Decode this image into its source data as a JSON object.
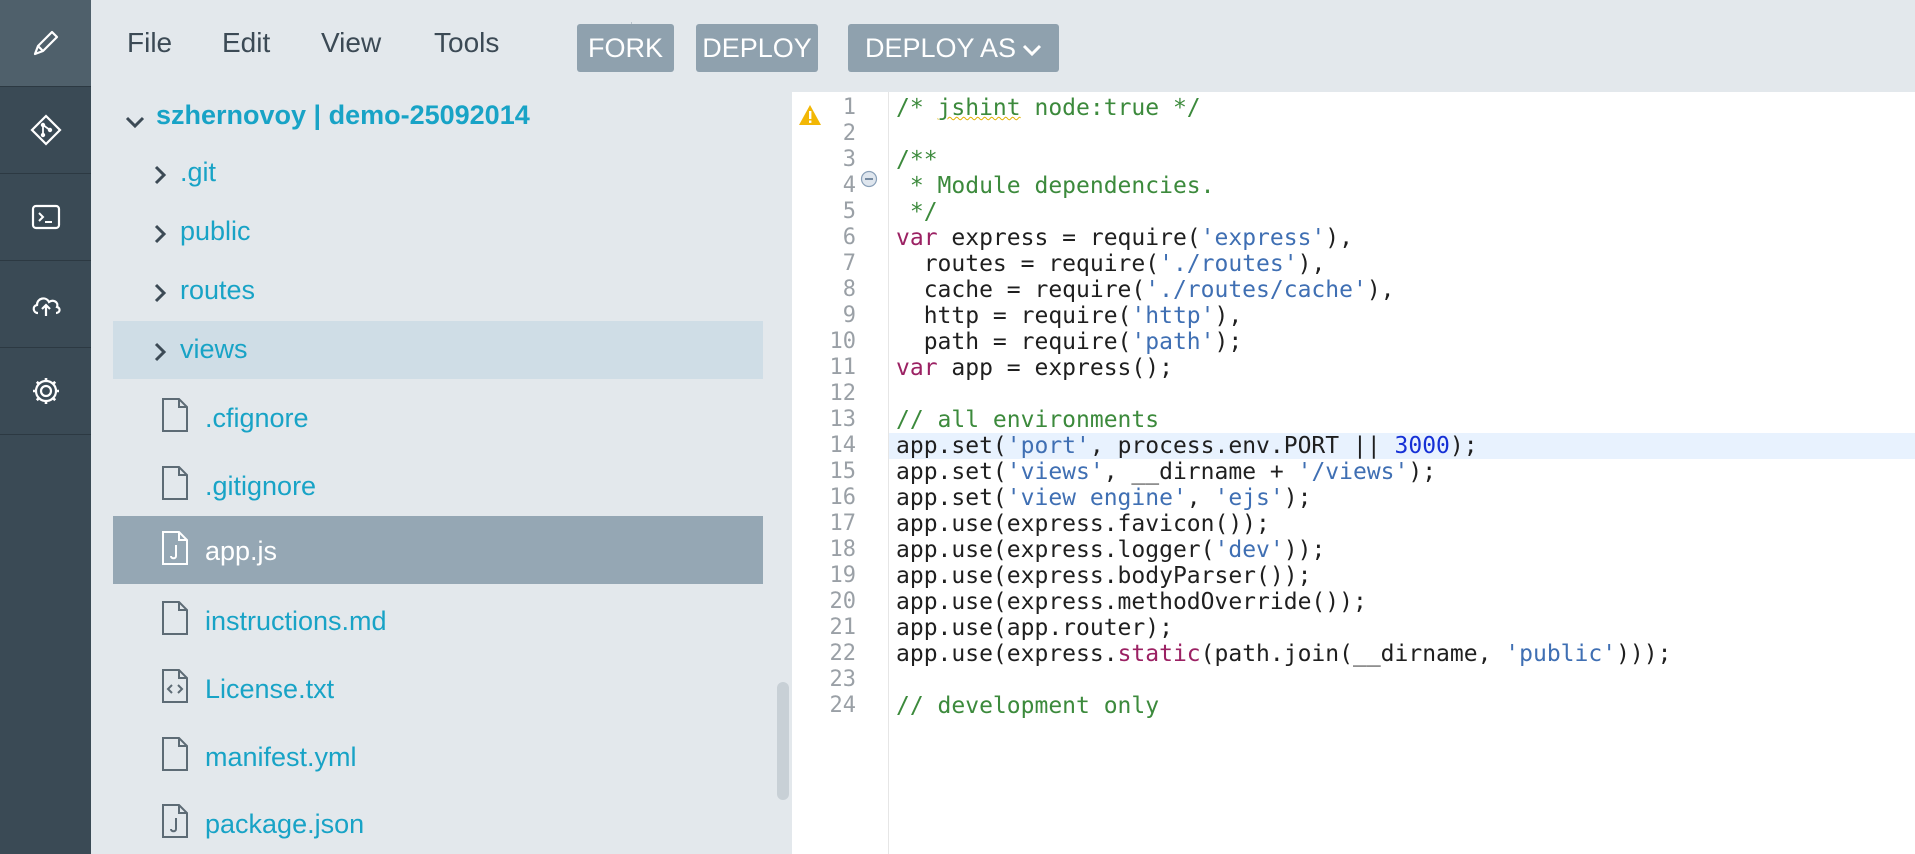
{
  "rail": {
    "items": [
      {
        "icon": "pencil-icon",
        "active": true
      },
      {
        "icon": "git-icon",
        "active": false
      },
      {
        "icon": "terminal-icon",
        "active": false
      },
      {
        "icon": "cloud-deploy-icon",
        "active": false
      },
      {
        "icon": "gear-icon",
        "active": false
      }
    ]
  },
  "menu": {
    "file": "File",
    "edit": "Edit",
    "view": "View",
    "tools": "Tools"
  },
  "toolbar": {
    "fork": "FORK",
    "deploy": "DEPLOY",
    "deploy_as": "DEPLOY AS"
  },
  "explorer": {
    "root": "szhernovoy | demo-25092014",
    "folders": [
      ".git",
      "public",
      "routes",
      "views"
    ],
    "files": [
      {
        "name": ".cfignore",
        "icon": "file-icon"
      },
      {
        "name": ".gitignore",
        "icon": "file-icon"
      },
      {
        "name": "app.js",
        "icon": "js-file-icon"
      },
      {
        "name": "instructions.md",
        "icon": "file-icon"
      },
      {
        "name": "License.txt",
        "icon": "code-file-icon"
      },
      {
        "name": "manifest.yml",
        "icon": "file-icon"
      },
      {
        "name": "package.json",
        "icon": "js-file-icon"
      }
    ],
    "selected_folder": "views",
    "selected_file": "app.js"
  },
  "editor": {
    "highlighted_line": 14,
    "lines": [
      "/* jshint node:true */",
      "",
      "/**",
      " * Module dependencies.",
      " */",
      "var express = require('express'),",
      "  routes = require('./routes'),",
      "  cache = require('./routes/cache'),",
      "  http = require('http'),",
      "  path = require('path');",
      "var app = express();",
      "",
      "// all environments",
      "app.set('port', process.env.PORT || 3000);",
      "app.set('views', __dirname + '/views');",
      "app.set('view engine', 'ejs');",
      "app.use(express.favicon());",
      "app.use(express.logger('dev'));",
      "app.use(express.bodyParser());",
      "app.use(express.methodOverride());",
      "app.use(app.router);",
      "app.use(express.static(path.join(__dirname, 'public')));",
      "",
      "// development only"
    ]
  },
  "colors": {
    "rail": "#3a4a55",
    "panel": "#e3e8ec",
    "accent_text": "#18a3c6",
    "button": "#8fa1ae",
    "selected_file": "#95a7b4"
  }
}
